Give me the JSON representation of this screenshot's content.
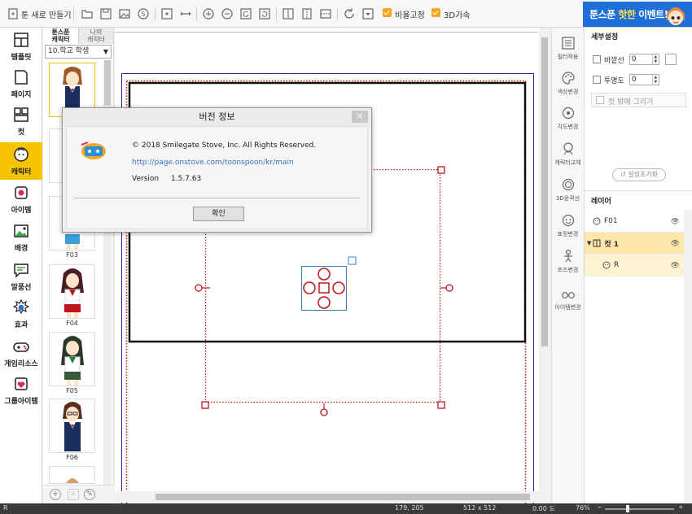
{
  "toolbar": {
    "new_label": "툰 새로 만들기",
    "ratio_lock_label": "비율고정",
    "accel_3d_label": "3D가속",
    "banner": {
      "prefix": "툰스푼",
      "hot": "핫한",
      "suffix": "이벤트!"
    }
  },
  "leftnav": {
    "items": [
      {
        "label": "템플릿",
        "icon": "template-icon"
      },
      {
        "label": "페이지",
        "icon": "page-icon"
      },
      {
        "label": "컷",
        "icon": "cut-icon"
      },
      {
        "label": "캐릭터",
        "icon": "character-icon",
        "active": true
      },
      {
        "label": "아이템",
        "icon": "item-icon"
      },
      {
        "label": "배경",
        "icon": "background-icon"
      },
      {
        "label": "말풍선",
        "icon": "speech-bubble-icon"
      },
      {
        "label": "효과",
        "icon": "effect-icon"
      },
      {
        "label": "게임리소스",
        "icon": "gamepad-icon"
      },
      {
        "label": "그룹아이템",
        "icon": "group-item-icon"
      }
    ]
  },
  "charpanel": {
    "tab_toonspoon": "툰스푼\n캐릭터",
    "tab_mine": "나의\n캐릭터",
    "category": "10.학교 학생",
    "labels": [
      "F03",
      "F04",
      "F05",
      "F06"
    ]
  },
  "righttools": {
    "items": [
      "필터적용",
      "색상변경",
      "각도변경",
      "캐릭터교체",
      "3D윤곽선",
      "표정변경",
      "포즈변경",
      "아이템변경"
    ]
  },
  "detail": {
    "title": "세부설정",
    "outline_label": "바깥선",
    "outline_value": "0",
    "opacity_label": "투명도",
    "opacity_value": "0",
    "draw_outside_label": "컷 밖에 그리기",
    "reset_label": "설정초기화"
  },
  "layers": {
    "title": "레이어",
    "items": [
      {
        "name": "F01",
        "type": "character"
      },
      {
        "name": "컷 1",
        "type": "cut",
        "selected": true
      },
      {
        "name": "R",
        "type": "character",
        "child": true
      }
    ]
  },
  "status": {
    "left": "R",
    "coords": "179, 205",
    "size": "512 x 512",
    "angle": "0.00 도",
    "zoom": "76%"
  },
  "modal": {
    "title": "버전 정보",
    "close": "×",
    "copyright": "© 2018 Smilegate Stove, Inc. All Rights Reserved.",
    "url": "http://page.onstove.com/toonspoon/kr/main",
    "version_label": "Version",
    "version_value": "1.5.7.63",
    "ok": "확인"
  },
  "colors": {
    "accent": "#f6c400",
    "selection": "#c0141c",
    "link": "#3b6fc5"
  }
}
